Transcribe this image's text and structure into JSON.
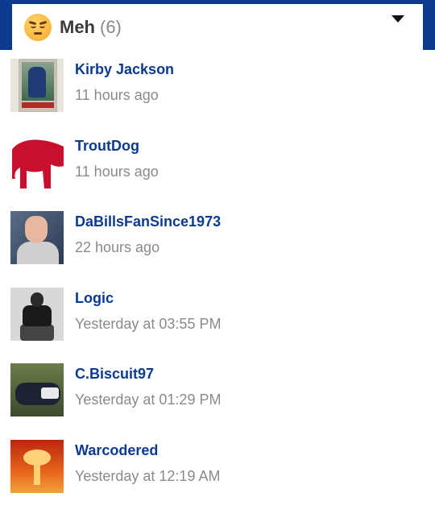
{
  "reaction": {
    "emoji_icon": "unamused-face-icon",
    "label": "Meh",
    "count": "(6)"
  },
  "users": [
    {
      "name": "Kirby Jackson",
      "time": "11 hours ago"
    },
    {
      "name": "TroutDog",
      "time": "11 hours ago"
    },
    {
      "name": "DaBillsFanSince1973",
      "time": "22 hours ago"
    },
    {
      "name": "Logic",
      "time": "Yesterday at 03:55 PM"
    },
    {
      "name": "C.Biscuit97",
      "time": "Yesterday at 01:29 PM"
    },
    {
      "name": "Warcodered",
      "time": "Yesterday at 12:19 AM"
    }
  ],
  "colors": {
    "brand": "#0b3a8f",
    "muted": "#8a8a8a",
    "bills_red": "#c8102e"
  }
}
